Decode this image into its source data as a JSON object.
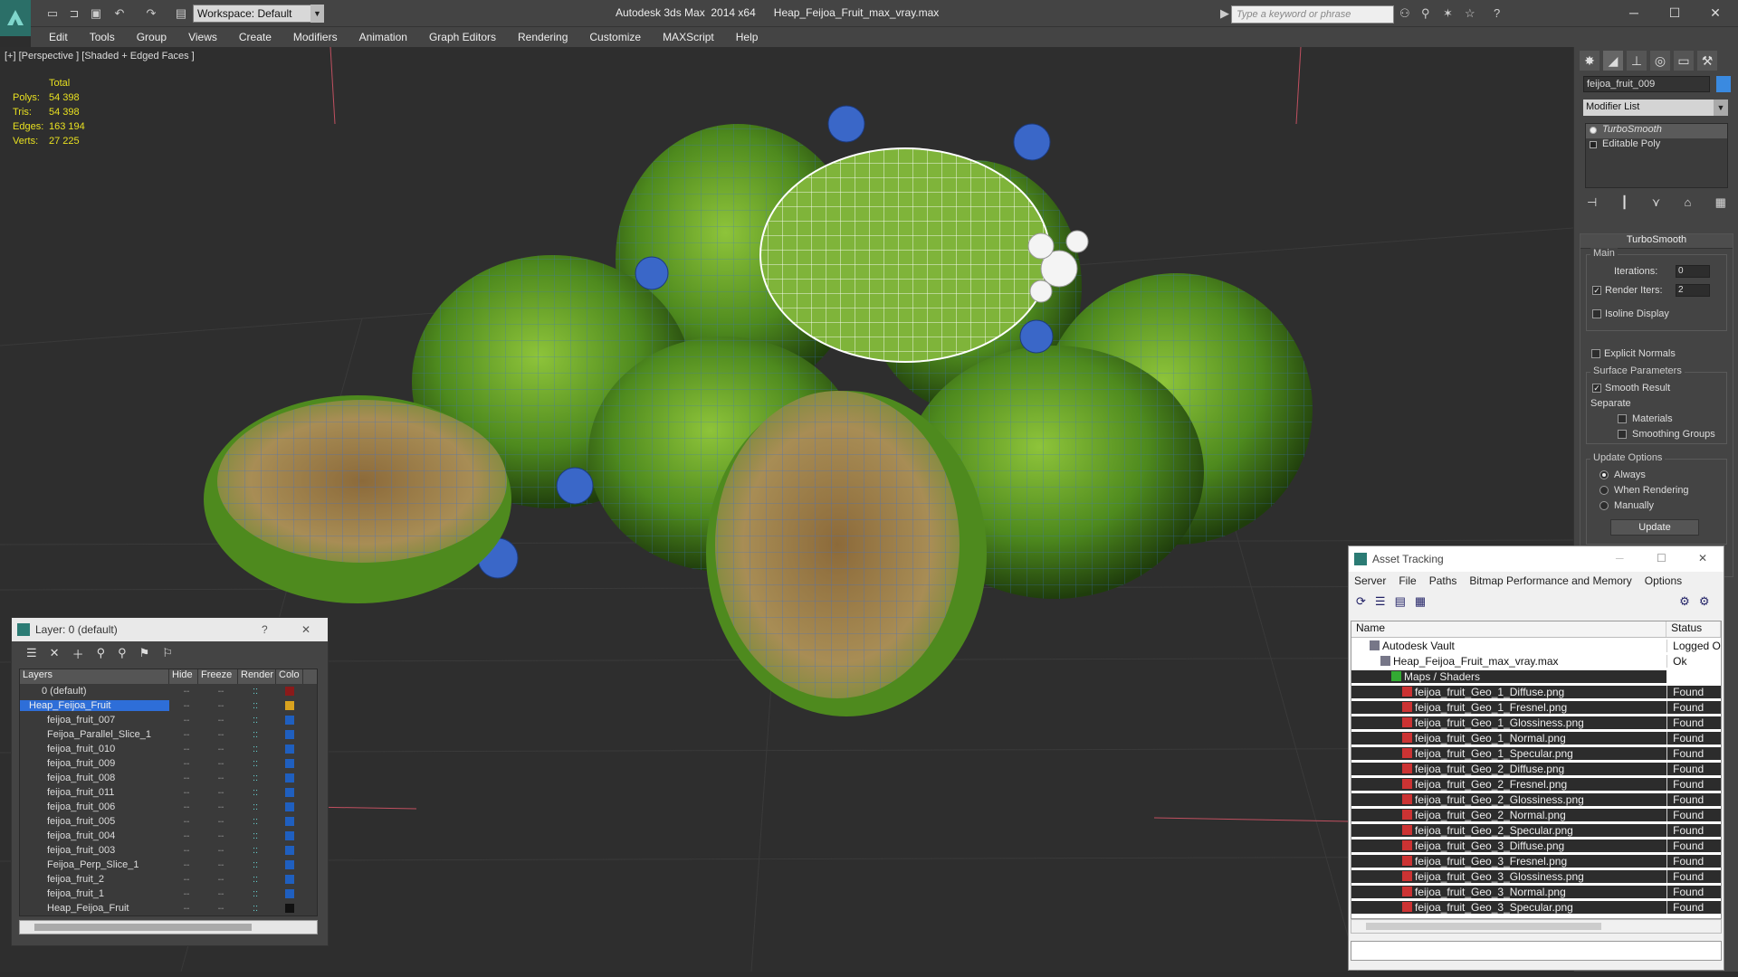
{
  "titlebar": {
    "workspace": "Workspace: Default",
    "app_title": "Autodesk 3ds Max  2014 x64",
    "file_title": "Heap_Feijoa_Fruit_max_vray.max",
    "search_placeholder": "Type a keyword or phrase"
  },
  "menu": [
    "Edit",
    "Tools",
    "Group",
    "Views",
    "Create",
    "Modifiers",
    "Animation",
    "Graph Editors",
    "Rendering",
    "Customize",
    "MAXScript",
    "Help"
  ],
  "viewport": {
    "label": "[+] [Perspective ] [Shaded + Edged Faces ]",
    "stats_header": "Total",
    "stats": [
      {
        "k": "Polys:",
        "v": "54 398"
      },
      {
        "k": "Tris:",
        "v": "54 398"
      },
      {
        "k": "Edges:",
        "v": "163 194"
      },
      {
        "k": "Verts:",
        "v": "27 225"
      }
    ]
  },
  "command_panel": {
    "object_name": "feijoa_fruit_009",
    "modifier_list": "Modifier List",
    "stack": [
      "TurboSmooth",
      "Editable Poly"
    ],
    "turbosmooth": {
      "title": "TurboSmooth",
      "main": "Main",
      "iterations_label": "Iterations:",
      "iterations": "0",
      "render_iters_label": "Render Iters:",
      "render_iters": "2",
      "isoline": "Isoline Display",
      "explicit": "Explicit Normals",
      "surface": "Surface Parameters",
      "smooth_result": "Smooth Result",
      "separate": "Separate",
      "materials": "Materials",
      "smoothing_groups": "Smoothing Groups",
      "update_options": "Update Options",
      "always": "Always",
      "when_rendering": "When Rendering",
      "manually": "Manually",
      "update": "Update"
    }
  },
  "layer_window": {
    "title": "Layer: 0 (default)",
    "help": "?",
    "columns": [
      "Layers",
      "Hide",
      "Freeze",
      "Render",
      "Colo"
    ],
    "rows": [
      {
        "name": "0 (default)",
        "color": "#8b1a1a"
      },
      {
        "name": "Heap_Feijoa_Fruit",
        "color": "#d9a21e"
      },
      {
        "name": "feijoa_fruit_007",
        "color": "#1f5fbf"
      },
      {
        "name": "Feijoa_Parallel_Slice_1",
        "color": "#1f5fbf"
      },
      {
        "name": "feijoa_fruit_010",
        "color": "#1f5fbf"
      },
      {
        "name": "feijoa_fruit_009",
        "color": "#1f5fbf"
      },
      {
        "name": "feijoa_fruit_008",
        "color": "#1f5fbf"
      },
      {
        "name": "feijoa_fruit_011",
        "color": "#1f5fbf"
      },
      {
        "name": "feijoa_fruit_006",
        "color": "#1f5fbf"
      },
      {
        "name": "feijoa_fruit_005",
        "color": "#1f5fbf"
      },
      {
        "name": "feijoa_fruit_004",
        "color": "#1f5fbf"
      },
      {
        "name": "feijoa_fruit_003",
        "color": "#1f5fbf"
      },
      {
        "name": "Feijoa_Perp_Slice_1",
        "color": "#1f5fbf"
      },
      {
        "name": "feijoa_fruit_2",
        "color": "#1f5fbf"
      },
      {
        "name": "feijoa_fruit_1",
        "color": "#1f5fbf"
      },
      {
        "name": "Heap_Feijoa_Fruit",
        "color": "#111111"
      }
    ]
  },
  "asset_window": {
    "title": "Asset Tracking",
    "menu": [
      "Server",
      "File",
      "Paths",
      "Bitmap Performance and Memory",
      "Options"
    ],
    "columns": [
      "Name",
      "Status"
    ],
    "rows": [
      {
        "name": "Autodesk Vault",
        "status": "Logged O"
      },
      {
        "name": "Heap_Feijoa_Fruit_max_vray.max",
        "status": "Ok"
      },
      {
        "name": "Maps / Shaders",
        "status": ""
      },
      {
        "name": "feijoa_fruit_Geo_1_Diffuse.png",
        "status": "Found"
      },
      {
        "name": "feijoa_fruit_Geo_1_Fresnel.png",
        "status": "Found"
      },
      {
        "name": "feijoa_fruit_Geo_1_Glossiness.png",
        "status": "Found"
      },
      {
        "name": "feijoa_fruit_Geo_1_Normal.png",
        "status": "Found"
      },
      {
        "name": "feijoa_fruit_Geo_1_Specular.png",
        "status": "Found"
      },
      {
        "name": "feijoa_fruit_Geo_2_Diffuse.png",
        "status": "Found"
      },
      {
        "name": "feijoa_fruit_Geo_2_Fresnel.png",
        "status": "Found"
      },
      {
        "name": "feijoa_fruit_Geo_2_Glossiness.png",
        "status": "Found"
      },
      {
        "name": "feijoa_fruit_Geo_2_Normal.png",
        "status": "Found"
      },
      {
        "name": "feijoa_fruit_Geo_2_Specular.png",
        "status": "Found"
      },
      {
        "name": "feijoa_fruit_Geo_3_Diffuse.png",
        "status": "Found"
      },
      {
        "name": "feijoa_fruit_Geo_3_Fresnel.png",
        "status": "Found"
      },
      {
        "name": "feijoa_fruit_Geo_3_Glossiness.png",
        "status": "Found"
      },
      {
        "name": "feijoa_fruit_Geo_3_Normal.png",
        "status": "Found"
      },
      {
        "name": "feijoa_fruit_Geo_3_Specular.png",
        "status": "Found"
      }
    ]
  }
}
